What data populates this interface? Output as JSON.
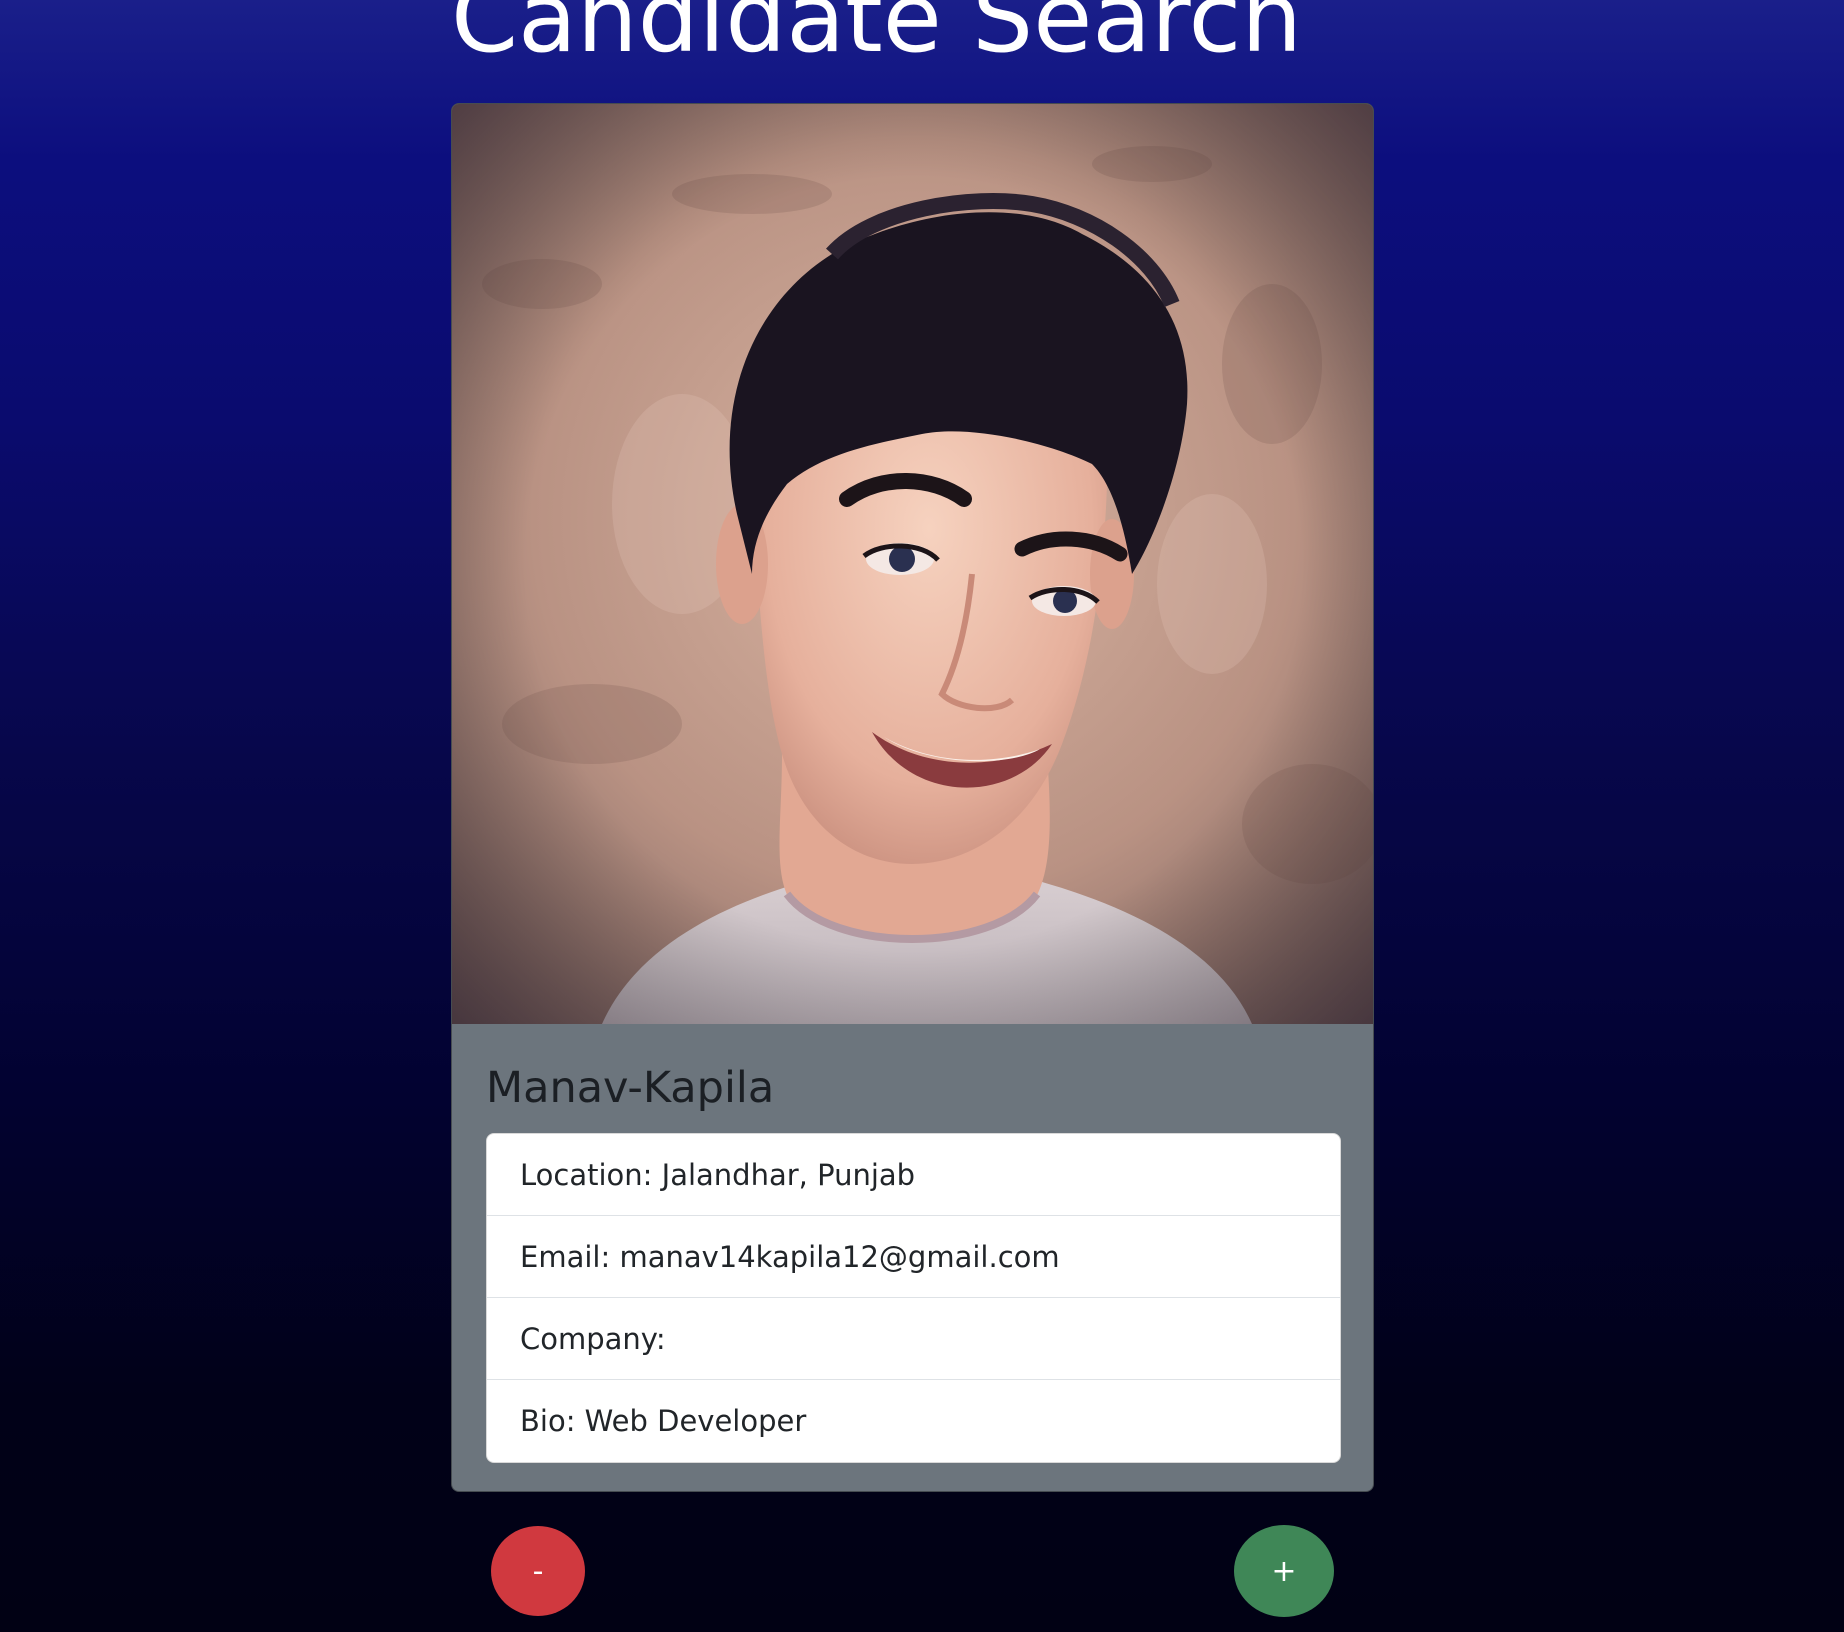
{
  "header": {
    "title": "Candidate Search"
  },
  "candidate": {
    "name": "Manav-Kapila",
    "avatar_icon": "candidate-avatar-photo",
    "details": {
      "location": "Location: Jalandhar, Punjab",
      "email": "Email: manav14kapila12@gmail.com",
      "company": "Company:",
      "bio": "Bio: Web Developer"
    }
  },
  "actions": {
    "reject_label": "-",
    "accept_label": "+",
    "reject_color": "#d0393f",
    "accept_color": "#3f8757"
  },
  "colors": {
    "card_background": "#6c757d",
    "page_gradient_top": "#1a1f8a",
    "page_gradient_bottom": "#010114"
  }
}
